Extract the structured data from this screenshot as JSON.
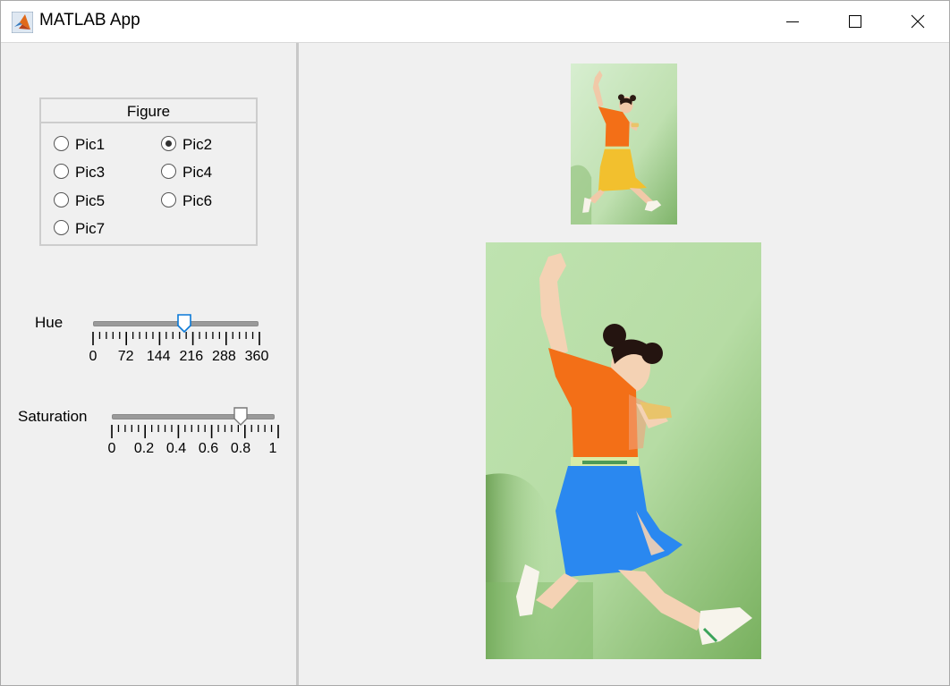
{
  "window": {
    "title": "MATLAB App"
  },
  "figure_group": {
    "title": "Figure",
    "options": [
      "Pic1",
      "Pic2",
      "Pic3",
      "Pic4",
      "Pic5",
      "Pic6",
      "Pic7"
    ],
    "selected": "Pic2"
  },
  "hue": {
    "label": "Hue",
    "min": 0,
    "max": 360,
    "value": 200,
    "tick_labels": [
      "0",
      "72",
      "144",
      "216",
      "288",
      "360"
    ],
    "thumb_color": "#0a79d7"
  },
  "saturation": {
    "label": "Saturation",
    "min": 0,
    "max": 1,
    "value": 0.8,
    "tick_labels": [
      "0",
      "0.2",
      "0.4",
      "0.6",
      "0.8",
      "1"
    ]
  },
  "colors": {
    "skirt_original": "#f2c02e",
    "skirt_adjusted": "#2a88f0",
    "shirt": "#f36f17",
    "background": "#c8e5b9"
  }
}
